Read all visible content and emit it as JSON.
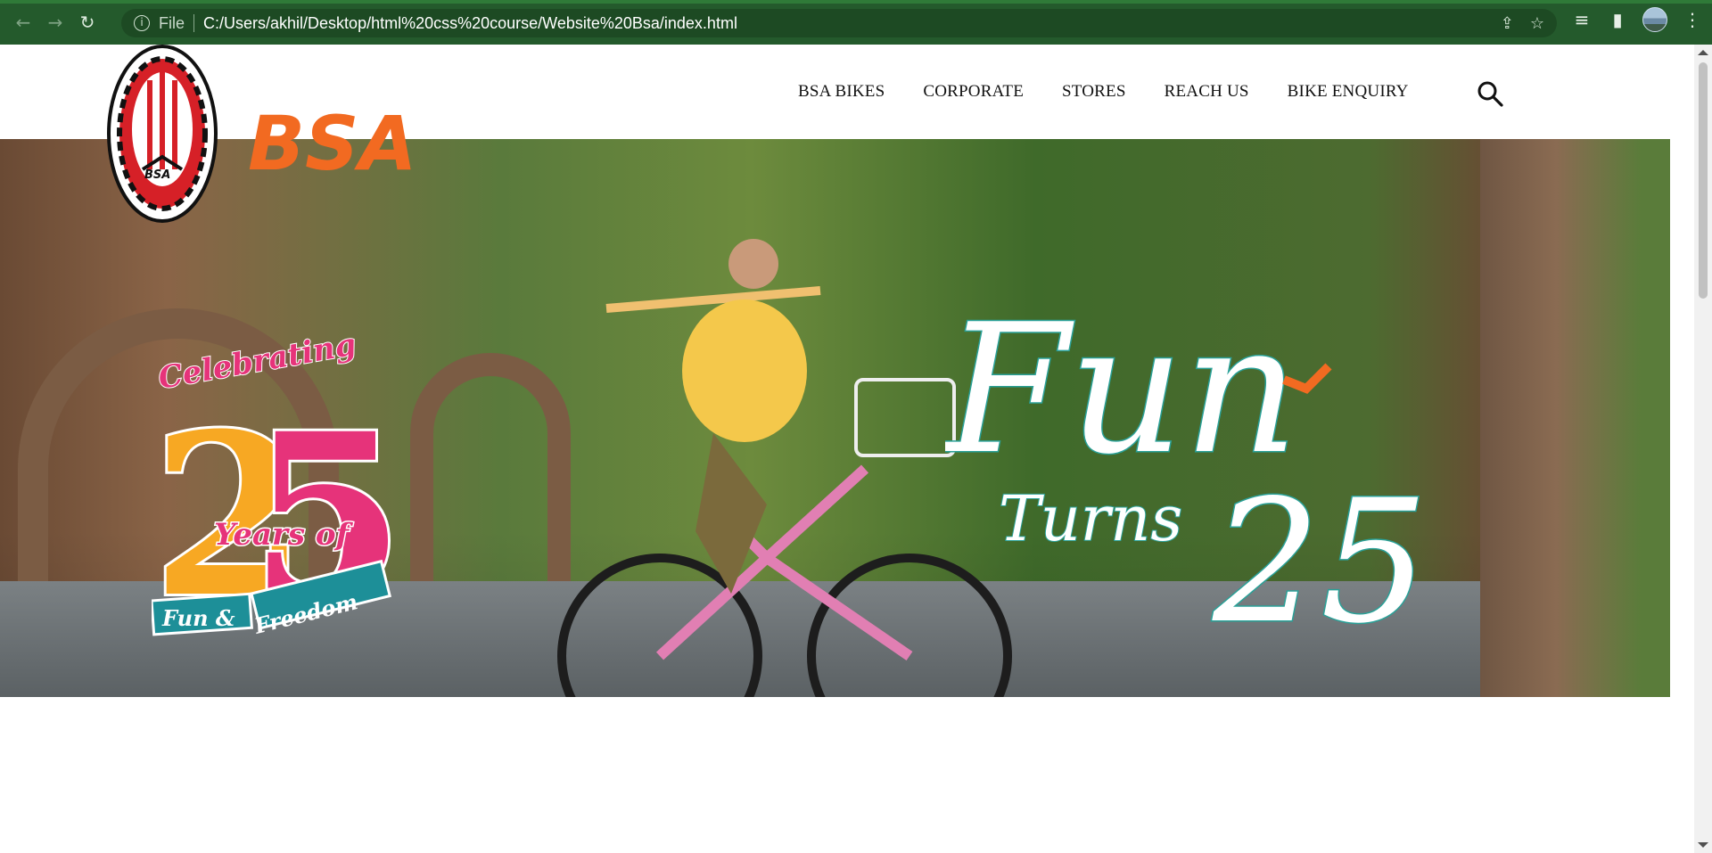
{
  "browser": {
    "back_icon": "back-arrow-icon",
    "forward_icon": "forward-arrow-icon",
    "reload_icon": "reload-icon",
    "scheme_label": "File",
    "url": "C:/Users/akhil/Desktop/html%20css%20course/Website%20Bsa/index.html"
  },
  "site": {
    "brand": "BSA",
    "logo_badge_text": "BSA",
    "menu": [
      {
        "label": "BSA BIKES"
      },
      {
        "label": "CORPORATE"
      },
      {
        "label": "STORES"
      },
      {
        "label": "REACH US"
      },
      {
        "label": "BIKE ENQUIRY"
      }
    ],
    "search_icon": "search-icon"
  },
  "hero": {
    "celebrating": "Celebrating",
    "number": "25",
    "years_of": "Years of",
    "fun_and": "Fun &",
    "freedom": "Freedom",
    "fun": "Fun",
    "turns": "Turns",
    "turns_number": "25"
  },
  "colors": {
    "chrome_green": "#245a2c",
    "brand_orange": "#f26a21",
    "pink": "#e6337a",
    "yellow": "#f7a823",
    "teal": "#1d8f98"
  }
}
